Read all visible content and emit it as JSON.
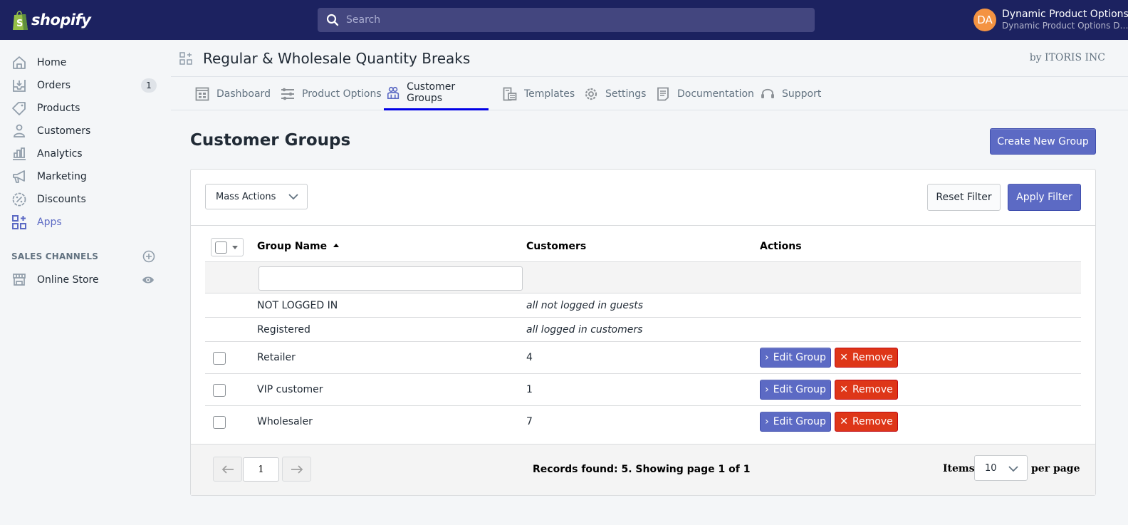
{
  "topbar": {
    "brand": "shopify",
    "search_placeholder": "Search",
    "account": {
      "initials": "DA",
      "name": "Dynamic Product Options",
      "store": "Dynamic Product Options Demo",
      "avatar_color": "#f49342"
    }
  },
  "sidebar": {
    "items": [
      {
        "label": "Home",
        "icon": "home-icon"
      },
      {
        "label": "Orders",
        "icon": "orders-icon",
        "badge": "1"
      },
      {
        "label": "Products",
        "icon": "tag-icon"
      },
      {
        "label": "Customers",
        "icon": "person-icon"
      },
      {
        "label": "Analytics",
        "icon": "bar-chart-icon"
      },
      {
        "label": "Marketing",
        "icon": "megaphone-icon"
      },
      {
        "label": "Discounts",
        "icon": "discount-icon"
      },
      {
        "label": "Apps",
        "icon": "apps-icon",
        "active": true
      }
    ],
    "sales_channels_title": "SALES CHANNELS",
    "channels": [
      {
        "label": "Online Store",
        "icon": "store-icon"
      }
    ]
  },
  "app": {
    "title": "Regular & Wholesale Quantity Breaks",
    "by": "by ITORIS INC",
    "tabs": [
      {
        "label": "Dashboard",
        "icon": "dashboard-icon"
      },
      {
        "label": "Product Options",
        "icon": "sliders-icon"
      },
      {
        "label": "Customer Groups",
        "icon": "group-icon",
        "active": true
      },
      {
        "label": "Templates",
        "icon": "templates-icon"
      },
      {
        "label": "Settings",
        "icon": "gear-icon"
      },
      {
        "label": "Documentation",
        "icon": "document-icon"
      },
      {
        "label": "Support",
        "icon": "headset-icon"
      }
    ]
  },
  "page": {
    "title": "Customer Groups",
    "create_button": "Create New Group",
    "mass_actions": "Mass Actions",
    "reset_filter": "Reset Filter",
    "apply_filter": "Apply Filter",
    "columns": {
      "group_name": "Group Name",
      "customers": "Customers",
      "actions": "Actions"
    },
    "filter_group_name": "",
    "rows": [
      {
        "name": "NOT LOGGED IN",
        "customers": "all not logged in guests",
        "system": true
      },
      {
        "name": "Registered",
        "customers": "all logged in customers",
        "system": true
      },
      {
        "name": "Retailer",
        "customers": "4",
        "system": false
      },
      {
        "name": "VIP customer",
        "customers": "1",
        "system": false
      },
      {
        "name": "Wholesaler",
        "customers": "7",
        "system": false
      }
    ],
    "edit_label": "Edit Group",
    "remove_label": "Remove",
    "pagination": {
      "current_page": "1",
      "records_text": "Records found: 5. Showing page 1 of 1",
      "items_label": "Items",
      "per_page_value": "10",
      "per_page_label": "per page"
    }
  },
  "colors": {
    "topbar": "#1c2260",
    "primary": "#5c6ac4",
    "danger": "#de3618",
    "active_tab_underline": "#0000e6"
  }
}
